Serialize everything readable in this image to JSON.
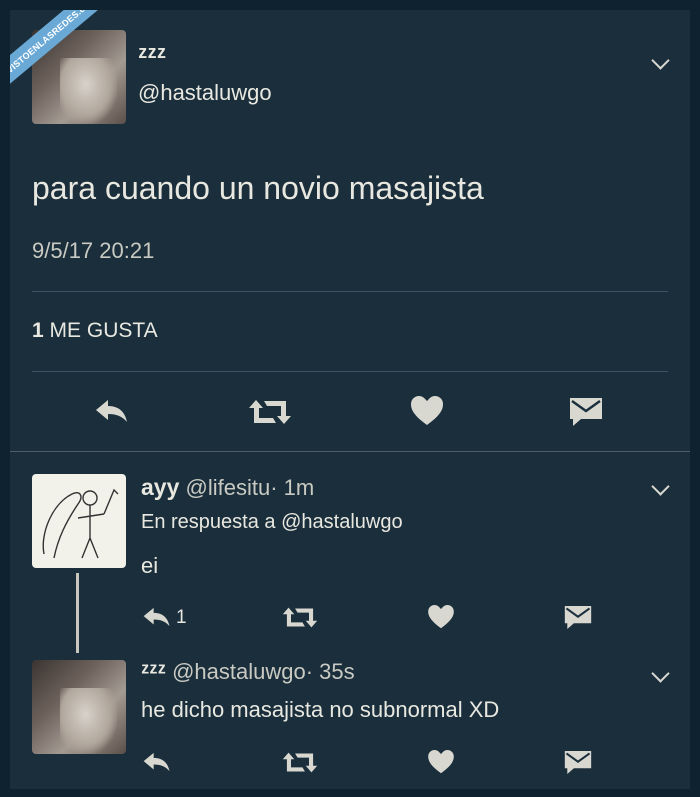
{
  "watermark": "VISTOENLASREDES.com",
  "main_tweet": {
    "display_name": "ᶻᶻᶻ",
    "handle": "@hastaluwgo",
    "text": "para cuando un novio masajista",
    "timestamp": "9/5/17 20:21",
    "likes_count": "1",
    "likes_label": "ME GUSTA"
  },
  "reply1": {
    "display_name": "ayy",
    "handle": "@lifesitu",
    "time": "· 1m",
    "in_reply_to": "En respuesta a @hastaluwgo",
    "text": "ei",
    "reply_count": "1"
  },
  "reply2": {
    "display_name": "ᶻᶻᶻ",
    "handle": "@hastaluwgo",
    "time": "· 35s",
    "text": "he dicho masajista no subnormal XD"
  },
  "colors": {
    "background": "#1a2e3c",
    "text": "#e8e8e0",
    "divider": "#3f5362",
    "watermark": "#6aa9d6"
  },
  "icons": [
    "reply-icon",
    "retweet-icon",
    "like-icon",
    "dm-icon",
    "chevron-down-icon"
  ]
}
